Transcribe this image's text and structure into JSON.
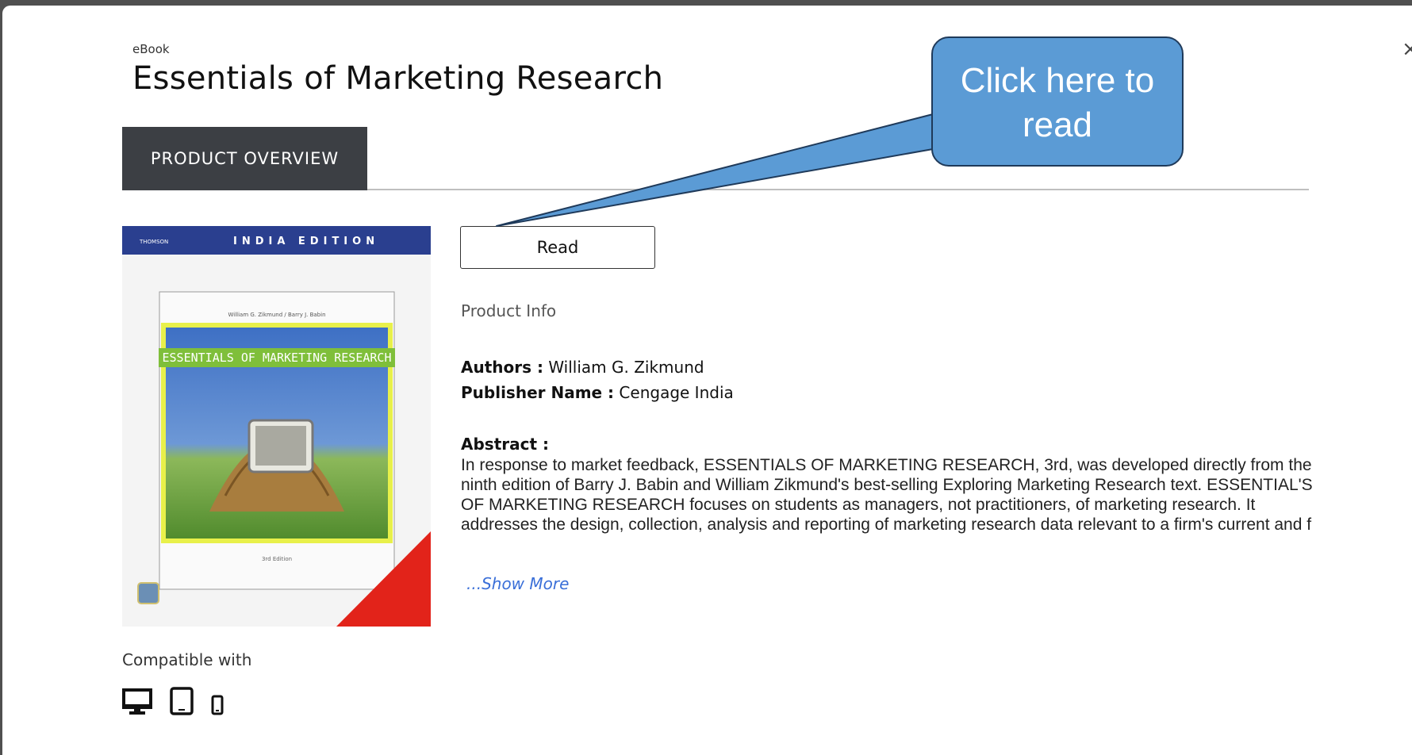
{
  "modal": {
    "close_glyph": "×",
    "eyebrow": "eBook",
    "title": "Essentials of Marketing Research"
  },
  "tabs": [
    {
      "label": "PRODUCT OVERVIEW",
      "active": true
    }
  ],
  "cover": {
    "publisher_mark": "THOMSON",
    "edition_banner": "INDIA EDITION",
    "authors_line": "William G. Zikmund / Barry J. Babin",
    "book_title": "ESSENTIALS OF MARKETING RESEARCH",
    "edition": "3rd Edition"
  },
  "actions": {
    "read_label": "Read"
  },
  "product_info": {
    "heading": "Product Info",
    "authors_label": "Authors :",
    "authors_value": "William G. Zikmund",
    "publisher_label": "Publisher Name :",
    "publisher_value": "Cengage India",
    "abstract_label": "Abstract :",
    "abstract_text": "In response to market feedback, ESSENTIALS OF MARKETING RESEARCH, 3rd, was developed directly from the ninth edition of Barry J. Babin and William Zikmund's best-selling Exploring Marketing Research text. ESSENTIAL'S OF MARKETING RESEARCH focuses on students as managers, not practitioners, of marketing research. It addresses the design, collection, analysis and reporting of marketing research data relevant to a firm's current and f",
    "show_more": "...Show More"
  },
  "compatibility": {
    "label": "Compatible with",
    "devices": [
      "desktop-icon",
      "tablet-icon",
      "mobile-icon"
    ]
  },
  "callout": {
    "text": "Click here to read",
    "fill": "#5b9bd5"
  },
  "colors": {
    "tab_bg": "#3c3f44",
    "link": "#3a6fd8"
  }
}
